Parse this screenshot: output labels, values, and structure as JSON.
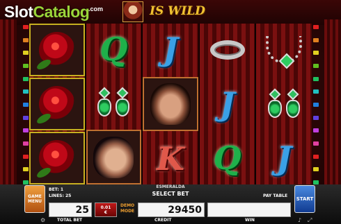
{
  "watermark": {
    "text_a": "Slot",
    "text_b": "Catalog",
    "suffix": ".com"
  },
  "header": {
    "wild_label": "IS WILD"
  },
  "reels": [
    [
      "rose",
      "rose",
      "rose"
    ],
    [
      "Q",
      "earrings",
      "man-portrait-2"
    ],
    [
      "J",
      "man-portrait-1",
      "K"
    ],
    [
      "ring",
      "J",
      "Q"
    ],
    [
      "necklace",
      "earrings",
      "J"
    ]
  ],
  "symbol_letters": {
    "Q": "Q",
    "J": "J",
    "K": "K"
  },
  "panel": {
    "game_menu": "GAME MENU",
    "bet_label": "BET: 1",
    "lines_label": "LINES: 25",
    "total_bet_value": "25",
    "total_bet_label": "TOTAL BET",
    "coin_value": "0.01",
    "coin_currency": "€",
    "demo_mode": "DEMO MODE",
    "credit_value": "29450",
    "credit_label": "CREDIT",
    "title": "ESMERALDA",
    "select_bet": "SELECT BET",
    "pay_table": "PAY TABLE",
    "win_label": "WIN",
    "win_value": "",
    "start": "START"
  },
  "colors": {
    "background": "#2a0606",
    "accent_gold": "#f0c232",
    "start_blue": "#2a6ad0",
    "menu_orange": "#e08a30"
  },
  "icons": [
    "rose-icon",
    "ring-icon",
    "earrings-icon",
    "necklace-icon",
    "settings-icon",
    "sound-icon",
    "fullscreen-icon"
  ]
}
